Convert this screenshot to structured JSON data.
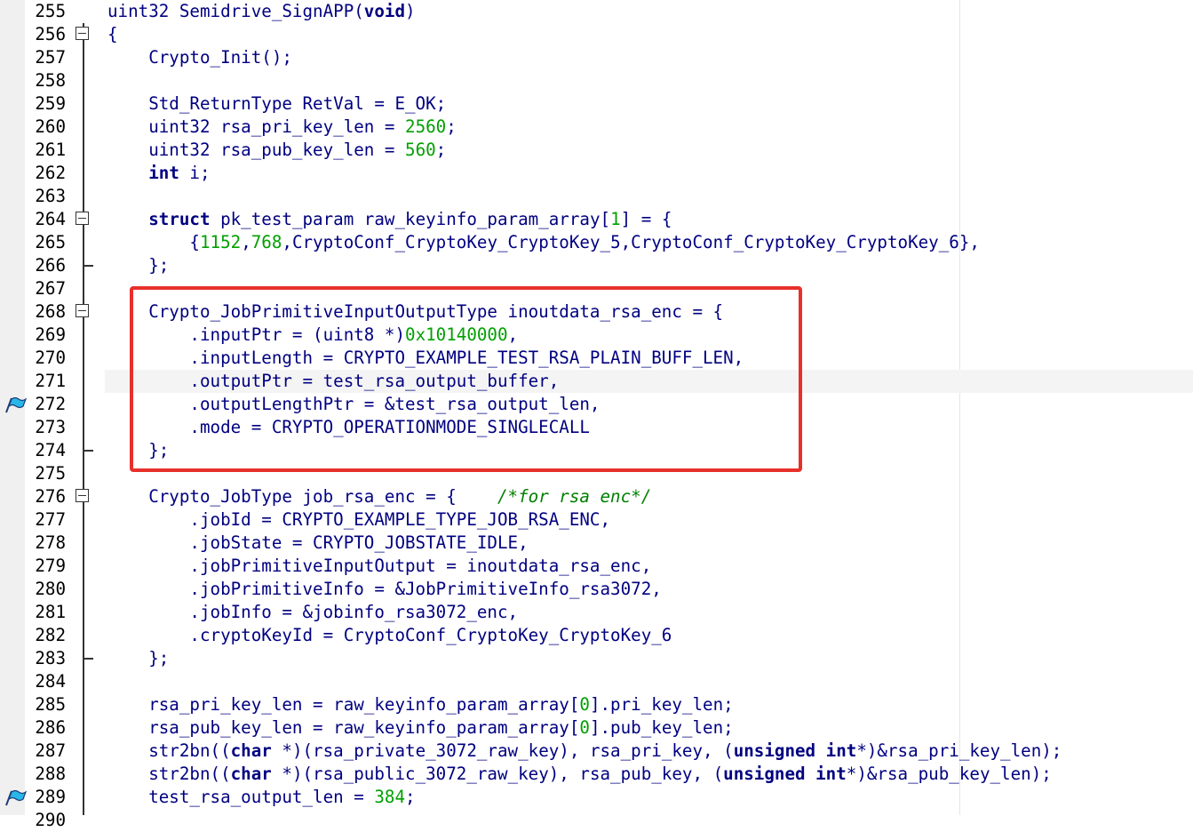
{
  "editor": {
    "lines": [
      {
        "n": "255",
        "tokens": [
          [
            "ident",
            "uint32 Semidrive_SignAPP("
          ],
          [
            "kw",
            "void"
          ],
          [
            "ident",
            ")"
          ]
        ]
      },
      {
        "n": "256",
        "fold": "open",
        "tokens": [
          [
            "ident",
            "{"
          ]
        ]
      },
      {
        "n": "257",
        "tokens": [
          [
            "ident",
            "    Crypto_Init();"
          ]
        ]
      },
      {
        "n": "258",
        "tokens": []
      },
      {
        "n": "259",
        "tokens": [
          [
            "ident",
            "    Std_ReturnType RetVal = E_OK;"
          ]
        ]
      },
      {
        "n": "260",
        "tokens": [
          [
            "ident",
            "    uint32 rsa_pri_key_len = "
          ],
          [
            "num",
            "2560"
          ],
          [
            "ident",
            ";"
          ]
        ]
      },
      {
        "n": "261",
        "tokens": [
          [
            "ident",
            "    uint32 rsa_pub_key_len = "
          ],
          [
            "num",
            "560"
          ],
          [
            "ident",
            ";"
          ]
        ]
      },
      {
        "n": "262",
        "tokens": [
          [
            "ident",
            "    "
          ],
          [
            "kw",
            "int"
          ],
          [
            "ident",
            " i;"
          ]
        ]
      },
      {
        "n": "263",
        "tokens": []
      },
      {
        "n": "264",
        "fold": "open",
        "tokens": [
          [
            "ident",
            "    "
          ],
          [
            "kw",
            "struct"
          ],
          [
            "ident",
            " pk_test_param raw_keyinfo_param_array["
          ],
          [
            "num",
            "1"
          ],
          [
            "ident",
            "] = {"
          ]
        ]
      },
      {
        "n": "265",
        "tokens": [
          [
            "ident",
            "        {"
          ],
          [
            "num",
            "1152"
          ],
          [
            "ident",
            ","
          ],
          [
            "num",
            "768"
          ],
          [
            "ident",
            ",CryptoConf_CryptoKey_CryptoKey_5,CryptoConf_CryptoKey_CryptoKey_6},"
          ]
        ]
      },
      {
        "n": "266",
        "fold": "end",
        "tokens": [
          [
            "ident",
            "    };"
          ]
        ]
      },
      {
        "n": "267",
        "tokens": []
      },
      {
        "n": "268",
        "fold": "open",
        "tokens": [
          [
            "ident",
            "    Crypto_JobPrimitiveInputOutputType inoutdata_rsa_enc = {"
          ]
        ]
      },
      {
        "n": "269",
        "tokens": [
          [
            "ident",
            "        .inputPtr = (uint8 *)"
          ],
          [
            "num",
            "0x10140000"
          ],
          [
            "ident",
            ","
          ]
        ]
      },
      {
        "n": "270",
        "tokens": [
          [
            "ident",
            "        .inputLength = CRYPTO_EXAMPLE_TEST_RSA_PLAIN_BUFF_LEN,"
          ]
        ]
      },
      {
        "n": "271",
        "current": true,
        "tokens": [
          [
            "ident",
            "        .outputPtr = test_rsa_output_buffer,"
          ]
        ]
      },
      {
        "n": "272",
        "bookmark": true,
        "tokens": [
          [
            "ident",
            "        .outputLengthPtr = &test_rsa_output_len,"
          ]
        ]
      },
      {
        "n": "273",
        "tokens": [
          [
            "ident",
            "        .mode = CRYPTO_OPERATIONMODE_SINGLECALL"
          ]
        ]
      },
      {
        "n": "274",
        "fold": "end",
        "tokens": [
          [
            "ident",
            "    };"
          ]
        ]
      },
      {
        "n": "275",
        "tokens": []
      },
      {
        "n": "276",
        "fold": "open",
        "tokens": [
          [
            "ident",
            "    Crypto_JobType job_rsa_enc = {    "
          ],
          [
            "cmt",
            "/*for rsa enc*/"
          ]
        ]
      },
      {
        "n": "277",
        "tokens": [
          [
            "ident",
            "        .jobId = CRYPTO_EXAMPLE_TYPE_JOB_RSA_ENC,"
          ]
        ]
      },
      {
        "n": "278",
        "tokens": [
          [
            "ident",
            "        .jobState = CRYPTO_JOBSTATE_IDLE,"
          ]
        ]
      },
      {
        "n": "279",
        "tokens": [
          [
            "ident",
            "        .jobPrimitiveInputOutput = inoutdata_rsa_enc,"
          ]
        ]
      },
      {
        "n": "280",
        "tokens": [
          [
            "ident",
            "        .jobPrimitiveInfo = &JobPrimitiveInfo_rsa3072,"
          ]
        ]
      },
      {
        "n": "281",
        "tokens": [
          [
            "ident",
            "        .jobInfo = &jobinfo_rsa3072_enc,"
          ]
        ]
      },
      {
        "n": "282",
        "tokens": [
          [
            "ident",
            "        .cryptoKeyId = CryptoConf_CryptoKey_CryptoKey_6"
          ]
        ]
      },
      {
        "n": "283",
        "fold": "end",
        "tokens": [
          [
            "ident",
            "    };"
          ]
        ]
      },
      {
        "n": "284",
        "tokens": []
      },
      {
        "n": "285",
        "tokens": [
          [
            "ident",
            "    rsa_pri_key_len = raw_keyinfo_param_array["
          ],
          [
            "num",
            "0"
          ],
          [
            "ident",
            "].pri_key_len;"
          ]
        ]
      },
      {
        "n": "286",
        "tokens": [
          [
            "ident",
            "    rsa_pub_key_len = raw_keyinfo_param_array["
          ],
          [
            "num",
            "0"
          ],
          [
            "ident",
            "].pub_key_len;"
          ]
        ]
      },
      {
        "n": "287",
        "tokens": [
          [
            "ident",
            "    str2bn(("
          ],
          [
            "kw",
            "char"
          ],
          [
            "ident",
            " *)(rsa_private_3072_raw_key), rsa_pri_key, ("
          ],
          [
            "kw",
            "unsigned int"
          ],
          [
            "ident",
            "*)&rsa_pri_key_len);"
          ]
        ]
      },
      {
        "n": "288",
        "tokens": [
          [
            "ident",
            "    str2bn(("
          ],
          [
            "kw",
            "char"
          ],
          [
            "ident",
            " *)(rsa_public_3072_raw_key), rsa_pub_key, ("
          ],
          [
            "kw",
            "unsigned int"
          ],
          [
            "ident",
            "*)&rsa_pub_key_len);"
          ]
        ]
      },
      {
        "n": "289",
        "bookmark": true,
        "tokens": [
          [
            "ident",
            "    test_rsa_output_len = "
          ],
          [
            "num",
            "384"
          ],
          [
            "ident",
            ";"
          ]
        ]
      },
      {
        "n": "290",
        "tokens": []
      }
    ]
  },
  "colors": {
    "highlight_border": "#e8302a",
    "keyword": "#000080",
    "number": "#00a000",
    "comment": "#008000"
  }
}
